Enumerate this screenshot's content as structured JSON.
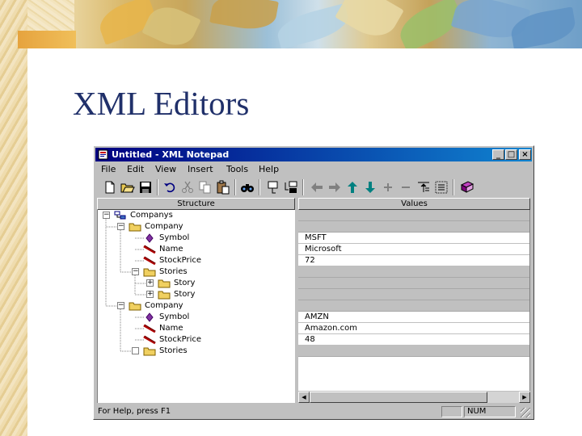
{
  "slide": {
    "title": "XML Editors"
  },
  "window": {
    "title": "Untitled - XML Notepad",
    "controls": {
      "minimize": "_",
      "maximize": "□",
      "close": "×"
    }
  },
  "menu": [
    "File",
    "Edit",
    "View",
    "Insert",
    "Tools",
    "Help"
  ],
  "toolbar_icons": [
    "new-icon",
    "open-icon",
    "save-icon",
    "undo-icon",
    "cut-icon",
    "copy-icon",
    "paste-icon",
    "find-icon",
    "insert-element-icon",
    "insert-child-icon",
    "left-arrow-icon",
    "right-arrow-icon",
    "up-arrow-icon",
    "down-arrow-icon",
    "expand-icon",
    "collapse-icon",
    "indent-icon",
    "outdent-icon",
    "help-book-icon"
  ],
  "panes": {
    "structure_header": "Structure",
    "values_header": "Values"
  },
  "tree": [
    {
      "label": "Companys",
      "level": 0,
      "kind": "root",
      "expander": "minus"
    },
    {
      "label": "Company",
      "level": 1,
      "kind": "folder",
      "expander": "minus"
    },
    {
      "label": "Symbol",
      "level": 2,
      "kind": "attribute"
    },
    {
      "label": "Name",
      "level": 2,
      "kind": "element"
    },
    {
      "label": "StockPrice",
      "level": 2,
      "kind": "element"
    },
    {
      "label": "Stories",
      "level": 2,
      "kind": "folder",
      "expander": "minus"
    },
    {
      "label": "Story",
      "level": 3,
      "kind": "folder",
      "expander": "plus"
    },
    {
      "label": "Story",
      "level": 3,
      "kind": "folder",
      "expander": "plus"
    },
    {
      "label": "Company",
      "level": 1,
      "kind": "folder",
      "expander": "minus"
    },
    {
      "label": "Symbol",
      "level": 2,
      "kind": "attribute"
    },
    {
      "label": "Name",
      "level": 2,
      "kind": "element"
    },
    {
      "label": "StockPrice",
      "level": 2,
      "kind": "element"
    },
    {
      "label": "Stories",
      "level": 2,
      "kind": "folder",
      "expander": "empty"
    }
  ],
  "values": [
    {
      "text": "",
      "style": "grey"
    },
    {
      "text": "",
      "style": "grey"
    },
    {
      "text": "MSFT",
      "style": "white"
    },
    {
      "text": "Microsoft",
      "style": "white"
    },
    {
      "text": "72",
      "style": "white"
    },
    {
      "text": "",
      "style": "grey"
    },
    {
      "text": "",
      "style": "grey"
    },
    {
      "text": "",
      "style": "grey"
    },
    {
      "text": "",
      "style": "grey"
    },
    {
      "text": "AMZN",
      "style": "white"
    },
    {
      "text": "Amazon.com",
      "style": "white"
    },
    {
      "text": "48",
      "style": "white"
    },
    {
      "text": "",
      "style": "grey"
    }
  ],
  "scrollbar": {
    "left_arrow": "◀",
    "right_arrow": "▶"
  },
  "status": {
    "help_text": "For Help, press F1",
    "num": "NUM"
  }
}
